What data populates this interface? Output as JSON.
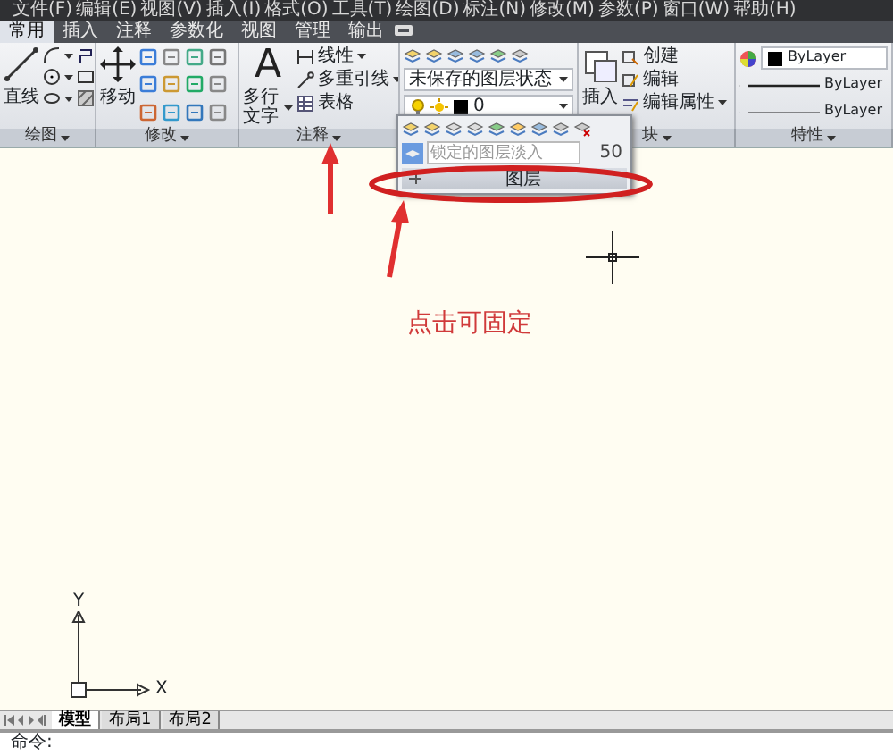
{
  "menu_bar": [
    "文件(F)",
    "编辑(E)",
    "视图(V)",
    "插入(I)",
    "格式(O)",
    "工具(T)",
    "绘图(D)",
    "标注(N)",
    "修改(M)",
    "参数(P)",
    "窗口(W)",
    "帮助(H)"
  ],
  "ribbon_tabs": [
    {
      "label": "常用",
      "selected": true
    },
    {
      "label": "插入",
      "selected": false
    },
    {
      "label": "注释",
      "selected": false
    },
    {
      "label": "参数化",
      "selected": false
    },
    {
      "label": "视图",
      "selected": false
    },
    {
      "label": "管理",
      "selected": false
    },
    {
      "label": "输出",
      "selected": false
    }
  ],
  "panels": [
    {
      "kind": "draw",
      "title": "绘图",
      "big_tool": "直线"
    },
    {
      "kind": "modify",
      "title": "修改",
      "big_tool": "移动"
    },
    {
      "kind": "annotate",
      "title": "注释",
      "glyph": "A",
      "big_tool": "多行文字",
      "tools": [
        {
          "label": "线性",
          "menu": true
        },
        {
          "label": "多重引线",
          "menu": true
        },
        {
          "label": "表格",
          "menu": false
        }
      ]
    },
    {
      "kind": "layers",
      "layer_state": "未保存的图层状态",
      "current_layer": "0",
      "flyout": {
        "fade_label": "锁定的图层淡入",
        "fade_value": "50",
        "title": "图层"
      }
    },
    {
      "kind": "block",
      "title": "块",
      "big_tool": "插入",
      "tools": [
        {
          "label": "创建",
          "menu": false
        },
        {
          "label": "编辑",
          "menu": false
        },
        {
          "label": "编辑属性",
          "menu": true
        }
      ]
    },
    {
      "kind": "properties",
      "title": "特性",
      "rows": [
        "ByLayer",
        "ByLayer",
        "ByLayer"
      ]
    }
  ],
  "callout": "点击可固定",
  "ucs": {
    "x_label": "X",
    "y_label": "Y"
  },
  "layout_tabs": [
    {
      "label": "模型",
      "selected": true
    },
    {
      "label": "布局1",
      "selected": false
    },
    {
      "label": "布局2",
      "selected": false
    }
  ],
  "command_line": [
    "命令:"
  ]
}
